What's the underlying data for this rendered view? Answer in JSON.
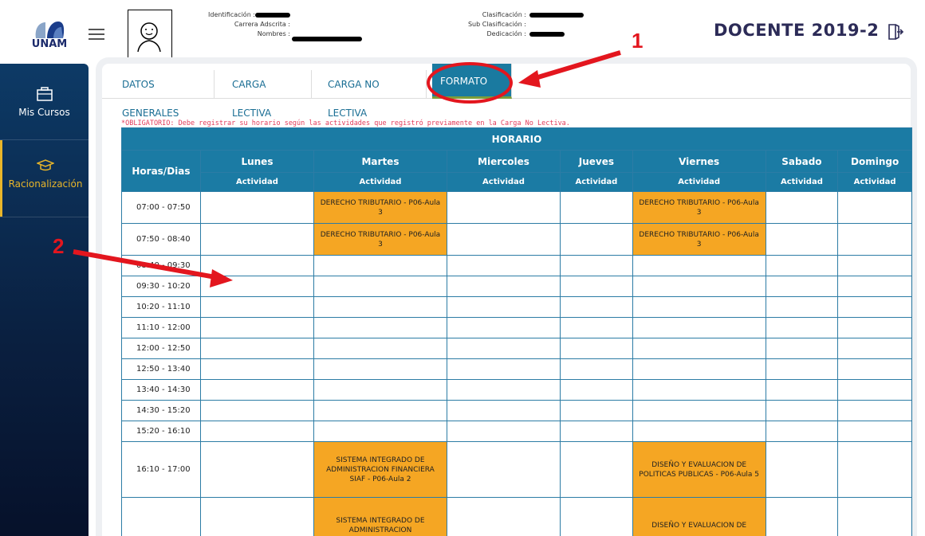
{
  "header": {
    "logo_text": "UNAM",
    "info_left": [
      {
        "label": "Identificación :"
      },
      {
        "label": "Carrera Adscrita :"
      },
      {
        "label": "Nombres :"
      }
    ],
    "info_right": [
      {
        "label": "Clasificación :"
      },
      {
        "label": "Sub Clasificación :"
      },
      {
        "label": "Dedicación :"
      }
    ],
    "title": "DOCENTE 2019-2"
  },
  "sidebar": {
    "items": [
      {
        "label": "Mis Cursos",
        "icon": "briefcase-icon"
      },
      {
        "label": "Racionalización",
        "icon": "graduation-cap-icon"
      }
    ]
  },
  "tabs": [
    {
      "label": "DATOS GENERALES"
    },
    {
      "label": "CARGA LECTIVA"
    },
    {
      "label": "CARGA NO LECTIVA"
    },
    {
      "label": "FORMATO #2"
    }
  ],
  "notice": "*OBLIGATORIO: Debe registrar su horario según las actividades que registró previamente en la Carga No Lectiva.",
  "table": {
    "title": "HORARIO",
    "hours_header": "Horas/Dias",
    "days": [
      "Lunes",
      "Martes",
      "Miercoles",
      "Jueves",
      "Viernes",
      "Sabado",
      "Domingo"
    ],
    "sub_header": "Actividad",
    "rows": [
      {
        "time": "07:00 - 07:50",
        "cells": [
          "",
          "DERECHO TRIBUTARIO - P06-Aula 3",
          "",
          "",
          "DERECHO TRIBUTARIO - P06-Aula 3",
          "",
          ""
        ]
      },
      {
        "time": "07:50 - 08:40",
        "cells": [
          "",
          "DERECHO TRIBUTARIO - P06-Aula 3",
          "",
          "",
          "DERECHO TRIBUTARIO - P06-Aula 3",
          "",
          ""
        ]
      },
      {
        "time": "08:40 - 09:30",
        "cells": [
          "",
          "",
          "",
          "",
          "",
          "",
          ""
        ]
      },
      {
        "time": "09:30 - 10:20",
        "cells": [
          "",
          "",
          "",
          "",
          "",
          "",
          ""
        ]
      },
      {
        "time": "10:20 - 11:10",
        "cells": [
          "",
          "",
          "",
          "",
          "",
          "",
          ""
        ]
      },
      {
        "time": "11:10 - 12:00",
        "cells": [
          "",
          "",
          "",
          "",
          "",
          "",
          ""
        ]
      },
      {
        "time": "12:00 - 12:50",
        "cells": [
          "",
          "",
          "",
          "",
          "",
          "",
          ""
        ]
      },
      {
        "time": "12:50 - 13:40",
        "cells": [
          "",
          "",
          "",
          "",
          "",
          "",
          ""
        ]
      },
      {
        "time": "13:40 - 14:30",
        "cells": [
          "",
          "",
          "",
          "",
          "",
          "",
          ""
        ]
      },
      {
        "time": "14:30 - 15:20",
        "cells": [
          "",
          "",
          "",
          "",
          "",
          "",
          ""
        ]
      },
      {
        "time": "15:20 - 16:10",
        "cells": [
          "",
          "",
          "",
          "",
          "",
          "",
          ""
        ]
      },
      {
        "time": "16:10 - 17:00",
        "cells": [
          "",
          "SISTEMA INTEGRADO DE ADMINISTRACION FINANCIERA SIAF - P06-Aula 2",
          "",
          "",
          "DISEÑO Y EVALUACION DE POLITICAS PUBLICAS - P06-Aula 5",
          "",
          ""
        ]
      },
      {
        "time": "",
        "cells": [
          "",
          "SISTEMA INTEGRADO DE ADMINISTRACION",
          "",
          "",
          "DISEÑO Y EVALUACION DE",
          "",
          ""
        ]
      }
    ]
  },
  "annotations": {
    "one": "1",
    "two": "2"
  },
  "colors": {
    "accent": "#1b7ba4",
    "activity": "#f5a623",
    "annotation": "#e3161e",
    "sidebar": "#0d3a66"
  }
}
